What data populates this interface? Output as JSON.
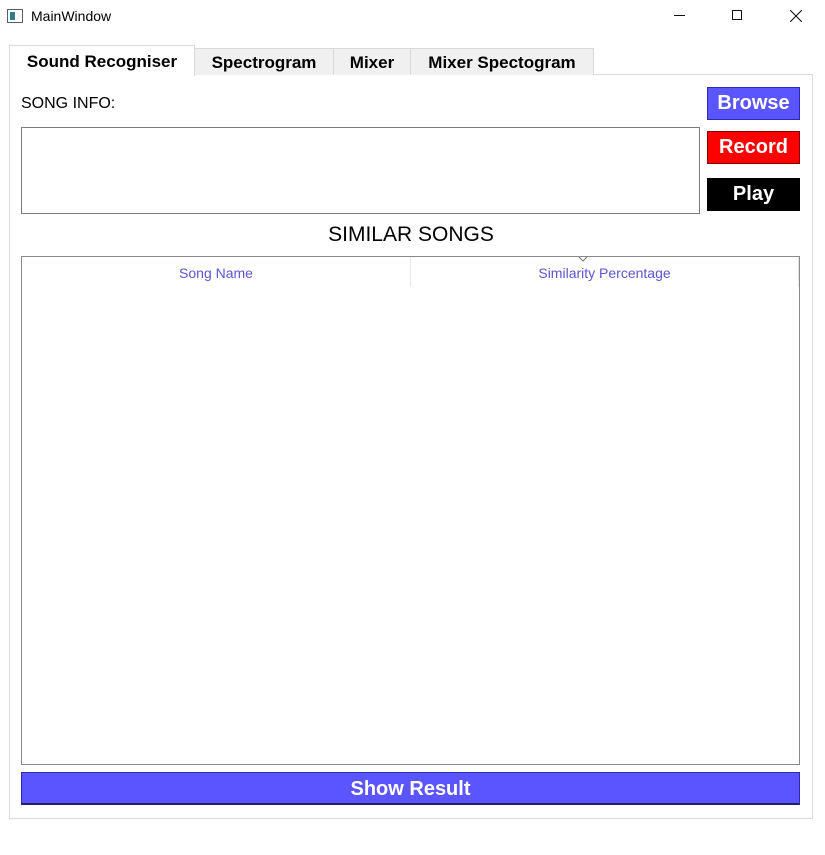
{
  "window": {
    "title": "MainWindow",
    "app_icon": "window-app-icon",
    "controls": [
      "minimize-icon",
      "maximize-icon",
      "close-icon"
    ]
  },
  "tabs": [
    {
      "label": "Sound Recogniser",
      "active": true
    },
    {
      "label": "Spectrogram",
      "active": false
    },
    {
      "label": "Mixer",
      "active": false
    },
    {
      "label": "Mixer Spectogram",
      "active": false
    }
  ],
  "song_info": {
    "label": "SONG INFO:",
    "value": ""
  },
  "buttons": {
    "browse": "Browse",
    "record": "Record",
    "play": "Play",
    "show_result": "Show Result"
  },
  "similar_songs": {
    "title": "SIMILAR SONGS",
    "columns": [
      "Song Name",
      "Similarity Percentage"
    ],
    "sorted_column": "Similarity Percentage",
    "rows": []
  },
  "colors": {
    "browse": "#5a55ff",
    "record": "#ff0000",
    "play": "#000000",
    "show_result": "#5a55ff",
    "header_text": "#5a55d6"
  }
}
